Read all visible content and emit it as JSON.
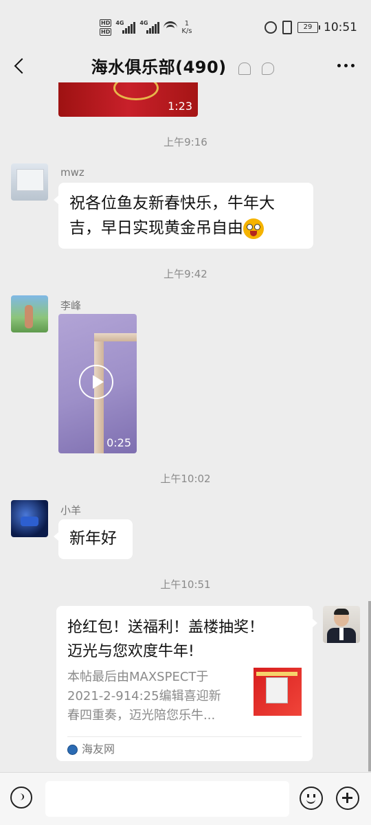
{
  "status_bar": {
    "network_speed_value": "1",
    "network_speed_unit": "K/s",
    "battery": "29",
    "time": "10:51"
  },
  "header": {
    "title": "海水俱乐部(490)"
  },
  "messages": [
    {
      "type": "video",
      "duration": "1:23"
    },
    {
      "type": "timestamp",
      "text": "上午9:16"
    },
    {
      "type": "text",
      "sender": "mwz",
      "text_line1": "祝各位鱼友新春快乐，牛年大",
      "text_line2": "吉，早日实现黄金吊自由"
    },
    {
      "type": "timestamp",
      "text": "上午9:42"
    },
    {
      "type": "video",
      "sender": "李峰",
      "duration": "0:25"
    },
    {
      "type": "timestamp",
      "text": "上午10:02"
    },
    {
      "type": "text",
      "sender": "小羊",
      "text": "新年好"
    },
    {
      "type": "timestamp",
      "text": "上午10:51"
    },
    {
      "type": "link_card",
      "title_line1": "抢红包！送福利！盖楼抽奖！",
      "title_line2": "迈光与您欢度牛年!",
      "desc_line1": "本帖最后由MAXSPECT于",
      "desc_line2": "2021-2-914:25编辑喜迎新",
      "desc_line3": "春四重奏，迈光陪您乐牛...",
      "source": "海友网"
    }
  ],
  "colors": {
    "background": "#ededed",
    "bubble": "#ffffff",
    "timestamp": "#8a8a8a"
  }
}
